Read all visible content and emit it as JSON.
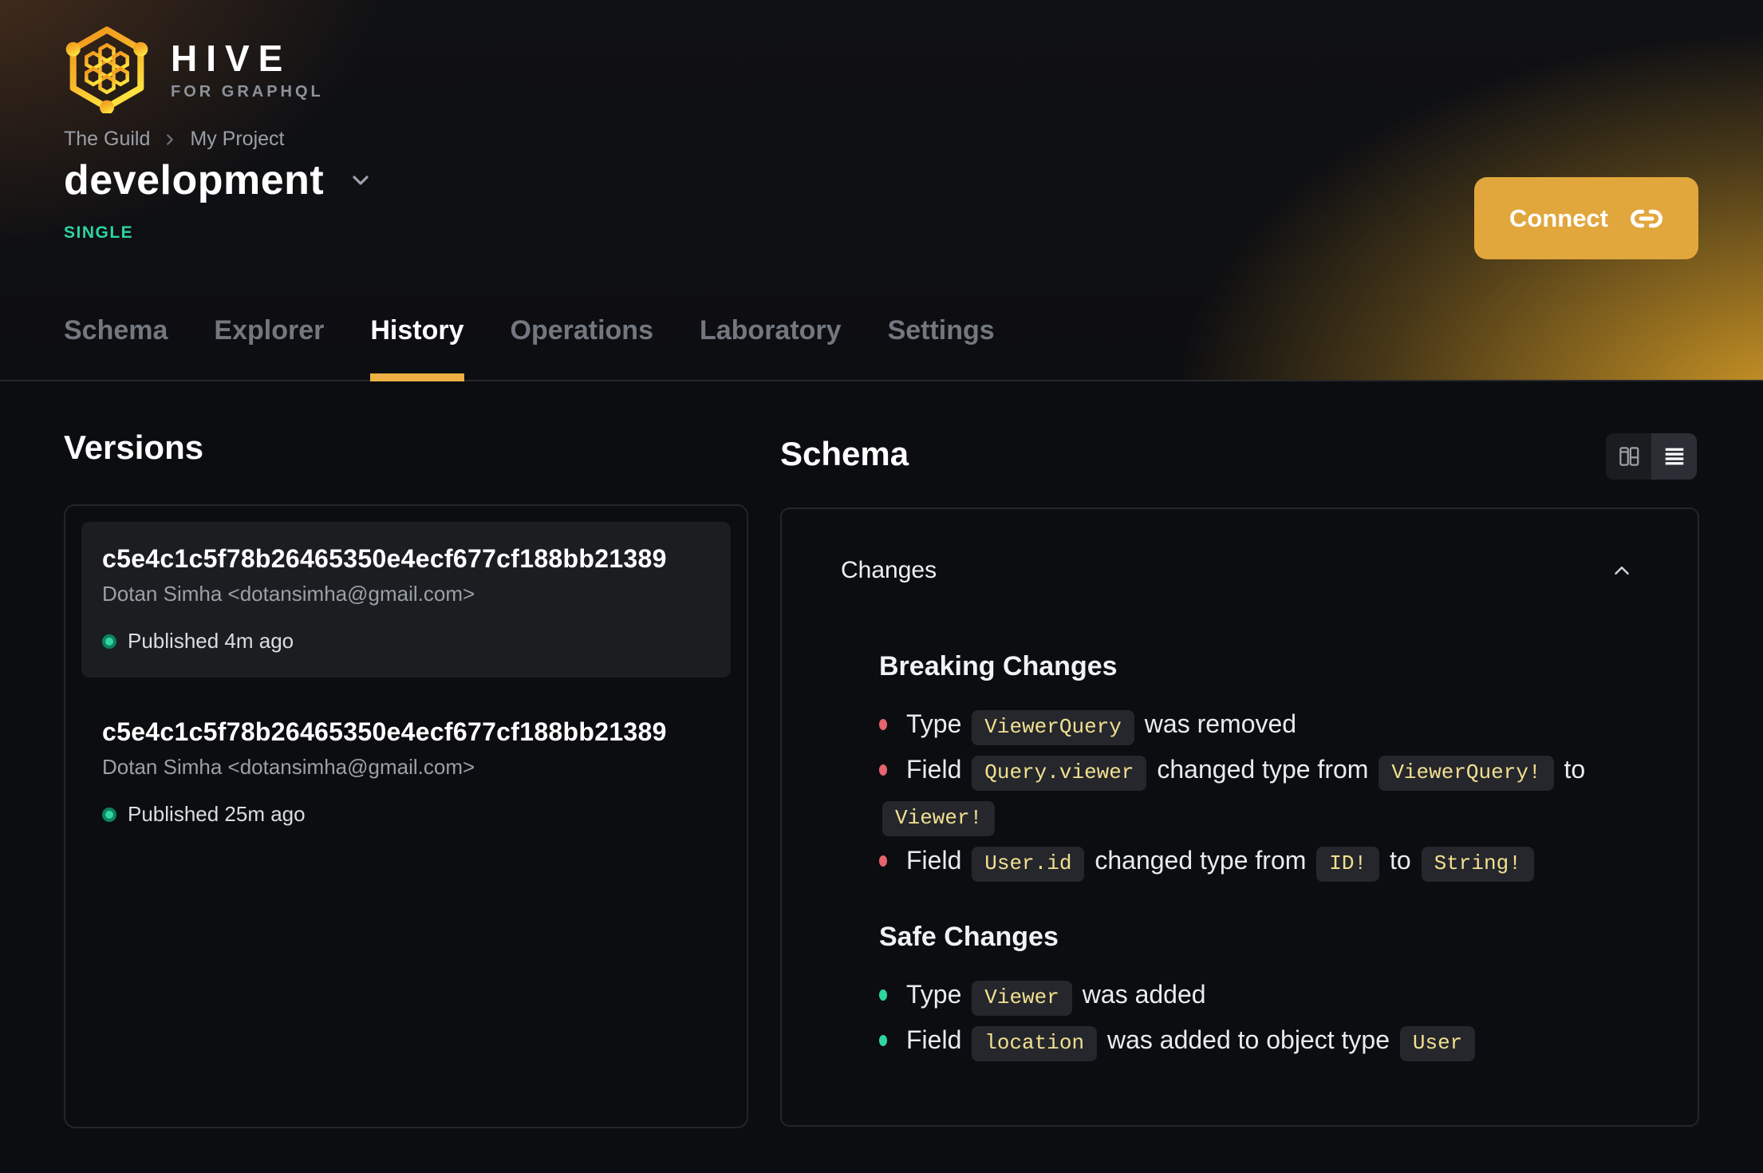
{
  "brand": {
    "name": "HIVE",
    "tagline": "FOR GRAPHQL"
  },
  "breadcrumb": {
    "items": [
      "The Guild",
      "My Project"
    ]
  },
  "project": {
    "title": "development",
    "badge": "SINGLE"
  },
  "header": {
    "connect_label": "Connect"
  },
  "tabs": [
    {
      "label": "Schema",
      "active": false
    },
    {
      "label": "Explorer",
      "active": false
    },
    {
      "label": "History",
      "active": true
    },
    {
      "label": "Operations",
      "active": false
    },
    {
      "label": "Laboratory",
      "active": false
    },
    {
      "label": "Settings",
      "active": false
    }
  ],
  "versions": {
    "title": "Versions",
    "items": [
      {
        "hash": "c5e4c1c5f78b26465350e4ecf677cf188bb21389",
        "author": "Dotan Simha <dotansimha@gmail.com>",
        "status": "Published 4m ago",
        "highlighted": true
      },
      {
        "hash": "c5e4c1c5f78b26465350e4ecf677cf188bb21389",
        "author": "Dotan Simha <dotansimha@gmail.com>",
        "status": "Published 25m ago",
        "highlighted": false
      }
    ]
  },
  "schema_panel": {
    "title": "Schema",
    "view_toggle": [
      "columns-view",
      "list-view"
    ],
    "changes": {
      "title": "Changes",
      "groups": [
        {
          "title": "Breaking Changes",
          "kind": "breaking",
          "items": [
            [
              {
                "t": "text",
                "v": "Type"
              },
              {
                "t": "code",
                "v": "ViewerQuery"
              },
              {
                "t": "text",
                "v": "was removed"
              }
            ],
            [
              {
                "t": "text",
                "v": "Field"
              },
              {
                "t": "code",
                "v": "Query.viewer"
              },
              {
                "t": "text",
                "v": "changed type from"
              },
              {
                "t": "code",
                "v": "ViewerQuery!"
              },
              {
                "t": "text",
                "v": "to"
              },
              {
                "t": "code",
                "v": "Viewer!"
              }
            ],
            [
              {
                "t": "text",
                "v": "Field"
              },
              {
                "t": "code",
                "v": "User.id"
              },
              {
                "t": "text",
                "v": "changed type from"
              },
              {
                "t": "code",
                "v": "ID!"
              },
              {
                "t": "text",
                "v": "to"
              },
              {
                "t": "code",
                "v": "String!"
              }
            ]
          ]
        },
        {
          "title": "Safe Changes",
          "kind": "safe",
          "items": [
            [
              {
                "t": "text",
                "v": "Type"
              },
              {
                "t": "code",
                "v": "Viewer"
              },
              {
                "t": "text",
                "v": "was added"
              }
            ],
            [
              {
                "t": "text",
                "v": "Field"
              },
              {
                "t": "code",
                "v": "location"
              },
              {
                "t": "text",
                "v": "was added to object type"
              },
              {
                "t": "code",
                "v": "User"
              }
            ]
          ]
        }
      ]
    }
  },
  "colors": {
    "accent": "#e7ab3a",
    "tab_underline": "#eeb044",
    "badge_green": "#2ed3a0",
    "breaking_bullet": "#e5646e",
    "safe_bullet": "#30d69e",
    "code_text": "#f2e091",
    "code_bg": "#25272c",
    "card_bg": "#1b1d21",
    "border": "#232528"
  }
}
